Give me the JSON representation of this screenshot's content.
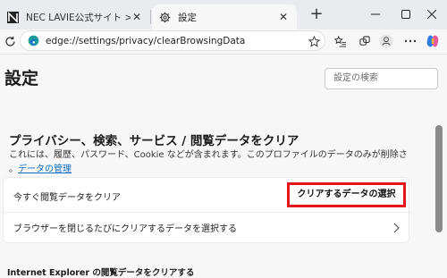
{
  "tabs": [
    {
      "title": "NEC LAVIE公式サイト > サービス＆サ",
      "active": false
    },
    {
      "title": "設定",
      "active": true
    }
  ],
  "address_bar": {
    "url": "edge://settings/privacy/clearBrowsingData"
  },
  "page": {
    "title": "設定",
    "search_placeholder": "設定の検索"
  },
  "section": {
    "title": "プライバシー、検索、サービス / 閲覧データをクリア",
    "description": "これには、履歴、パスワード、Cookie などが含まれます。このプロファイルのデータのみが削除さ",
    "manage_link": "データの管理"
  },
  "card": {
    "row1_label": "今すぐ閲覧データをクリア",
    "row1_button": "クリアするデータの選択",
    "row2_label": "ブラウザーを閉じるたびにクリアするデータを選択する"
  },
  "ie_section_title": "Internet Explorer の閲覧データをクリアする",
  "colors": {
    "accent": "#0f6cbd",
    "highlight": "#e8141c"
  }
}
